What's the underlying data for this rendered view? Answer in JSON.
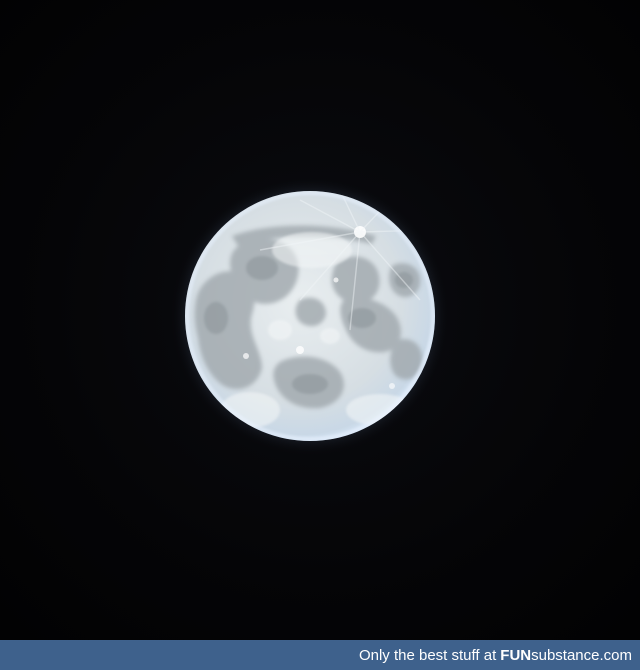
{
  "footer": {
    "tagline": "Only the best stuff at",
    "brand_bold": "FUN",
    "brand_rest": "substance.com",
    "background_color": "#3e618c",
    "text_color": "#ffffff"
  },
  "photo": {
    "subject": "full-moon",
    "sky_color": "#030304",
    "moon_color": "#dfe6ea",
    "halo_color": "#bcd2ef"
  }
}
